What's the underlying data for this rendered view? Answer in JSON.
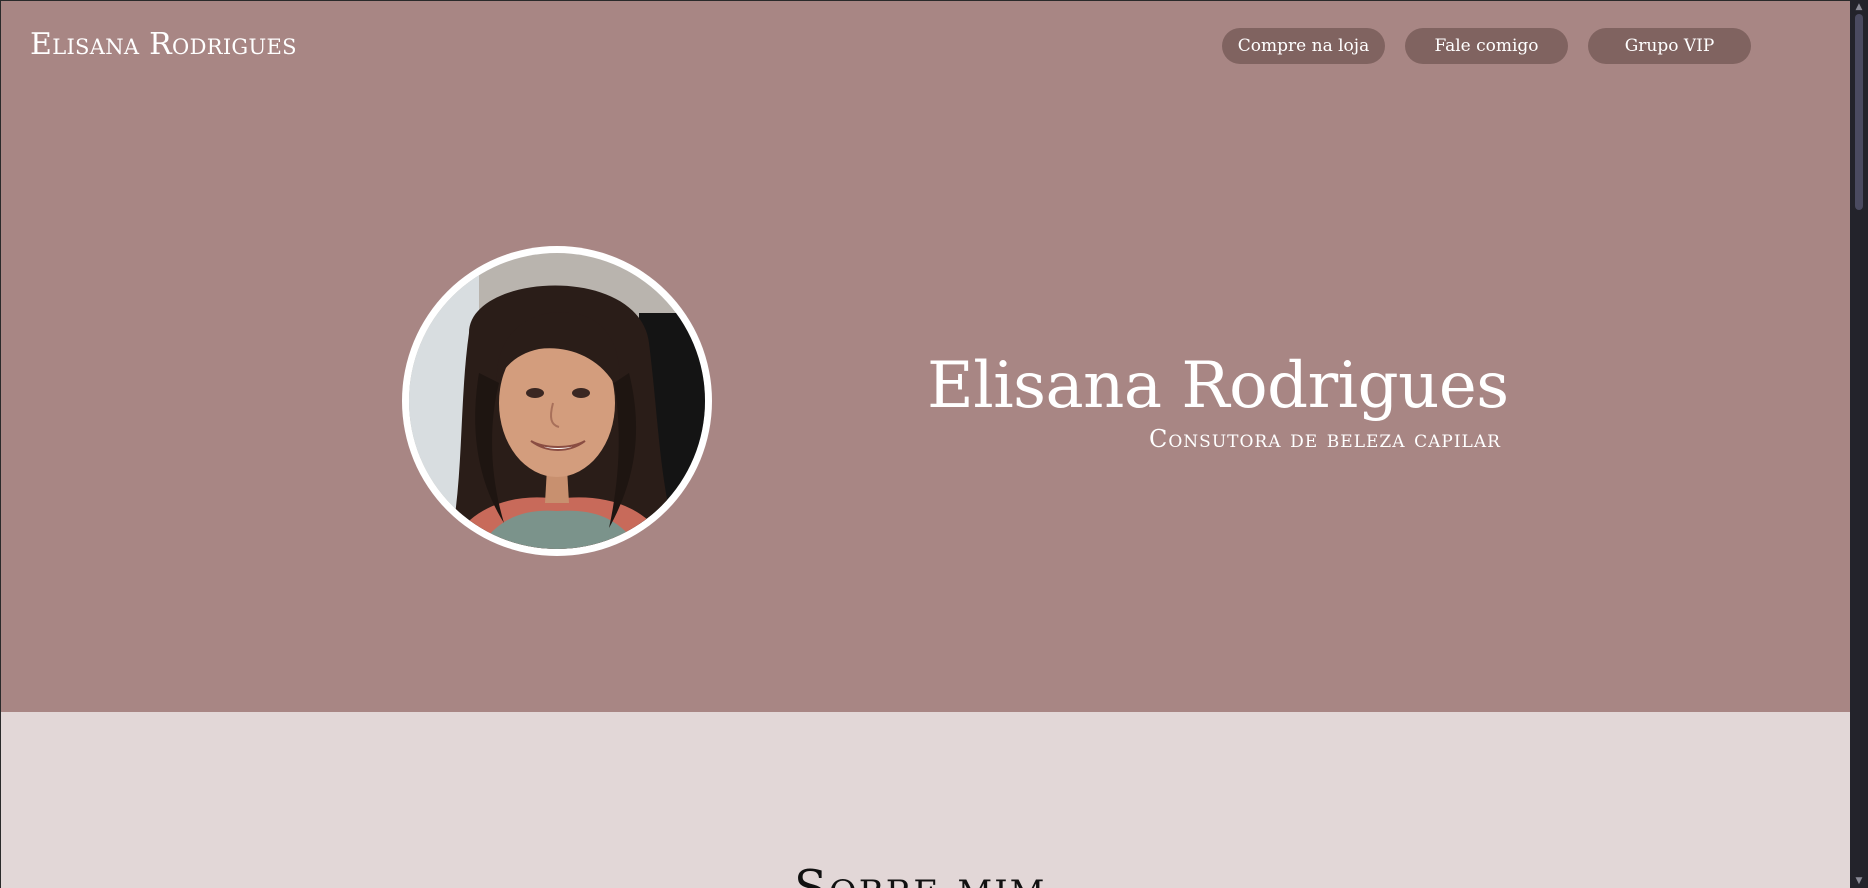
{
  "header": {
    "brand": "Elisana Rodrigues",
    "nav": [
      {
        "label": "Compre na loja"
      },
      {
        "label": "Fale comigo"
      },
      {
        "label": "Grupo VIP"
      }
    ]
  },
  "hero": {
    "name": "Elisana Rodrigues",
    "subtitle": "Consutora de beleza capilar",
    "photo_icon": "profile-photo"
  },
  "about": {
    "title": "Sobre mim"
  },
  "colors": {
    "hero_bg": "#a88684",
    "button_bg": "#806360",
    "about_bg": "#e2d7d7",
    "text_light": "#ffffff",
    "text_dark": "#111111"
  }
}
